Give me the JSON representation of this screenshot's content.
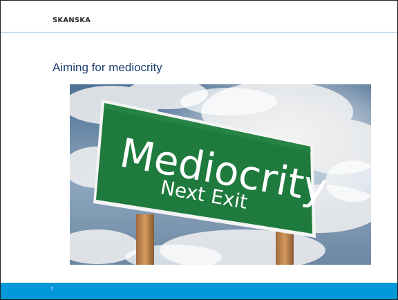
{
  "slide": {
    "brand": "SKANSKA",
    "title": "Aiming for mediocrity",
    "page_number": "7"
  },
  "image": {
    "sign_text_line1": "Mediocrity",
    "sign_text_line2": "Next Exit"
  },
  "colors": {
    "title": "#1a3f6f",
    "footer_bar": "#0098d8",
    "header_rule": "#8fb6d6",
    "sign_green": "#1f7a3e"
  }
}
